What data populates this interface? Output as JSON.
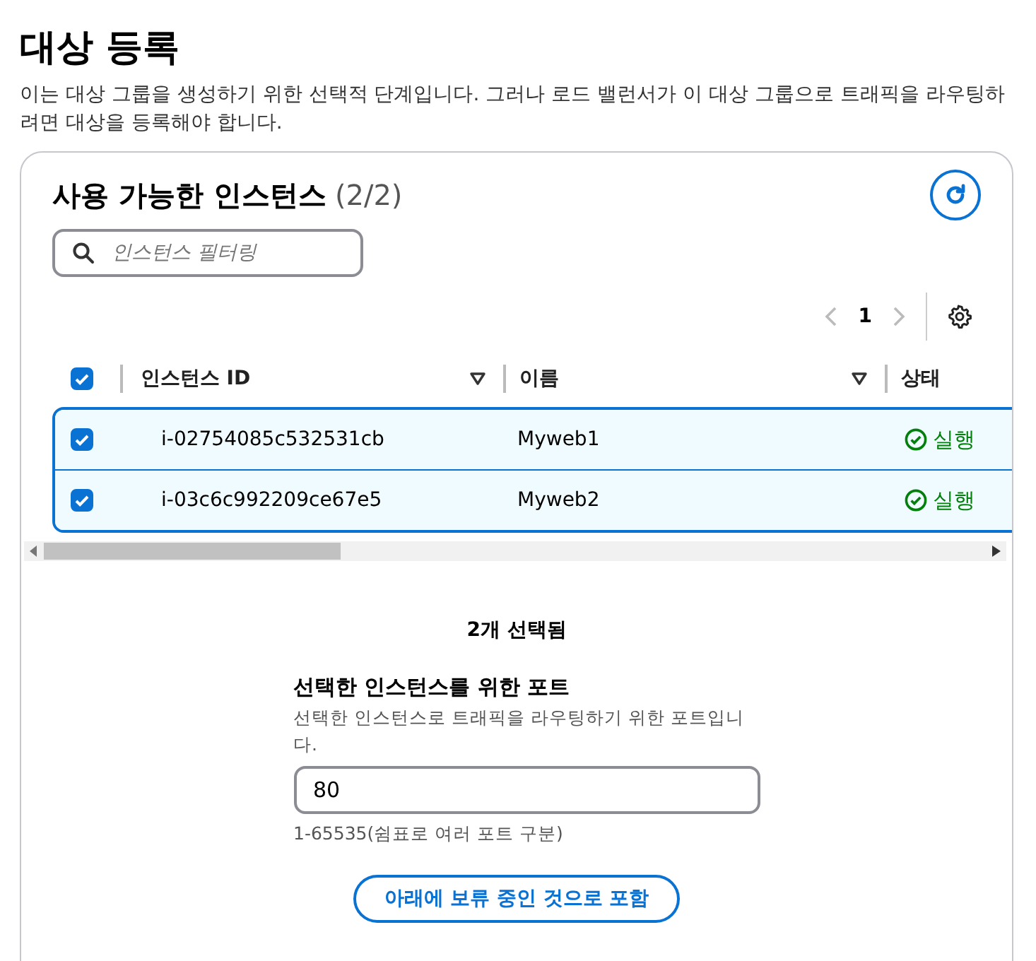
{
  "page": {
    "title": "대상 등록",
    "description": "이는 대상 그룹을 생성하기 위한 선택적 단계입니다. 그러나 로드 밸런서가 이 대상 그룹으로 트래픽을 라우팅하려면 대상을 등록해야 합니다."
  },
  "instances": {
    "title": "사용 가능한 인스턴스",
    "count": "(2/2)",
    "search": {
      "placeholder": "인스턴스 필터링"
    },
    "pagination": {
      "page": "1"
    },
    "select_all": {
      "checked": true
    },
    "columns": [
      {
        "label": "인스턴스 ID",
        "sortable": true
      },
      {
        "label": "이름",
        "sortable": true
      },
      {
        "label": "상태",
        "sortable": false
      }
    ],
    "rows": [
      {
        "selected": true,
        "id": "i-02754085c532531cb",
        "name": "Myweb1",
        "status": "실행"
      },
      {
        "selected": true,
        "id": "i-03c6c992209ce67e5",
        "name": "Myweb2",
        "status": "실행"
      }
    ]
  },
  "selection": {
    "summary": "2개 선택됨",
    "port_label": "선택한 인스턴스를 위한 포트",
    "port_description": "선택한 인스턴스로 트래픽을 라우팅하기 위한 포트입니다.",
    "port_value": "80",
    "port_hint": "1-65535(쉼표로 여러 포트 구분)",
    "include_button": "아래에 보류 중인 것으로 포함"
  }
}
